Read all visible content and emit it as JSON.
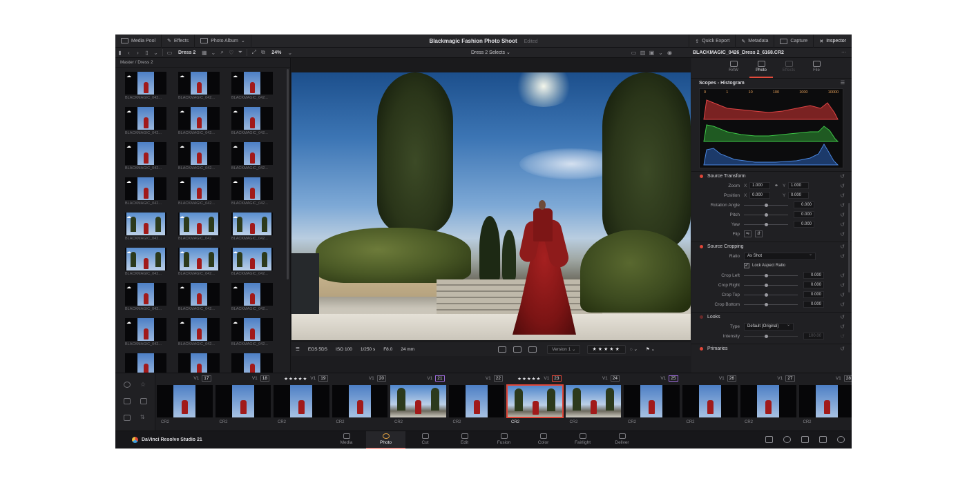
{
  "topbar": {
    "media_pool": "Media Pool",
    "effects": "Effects",
    "photo_album": "Photo Album",
    "project_title": "Blackmagic Fashion Photo Shoot",
    "edited": "Edited",
    "quick_export": "Quick Export",
    "metadata": "Metadata",
    "capture": "Capture",
    "inspector": "Inspector"
  },
  "toolbar": {
    "bin_name": "Dress 2",
    "zoom": "24%",
    "album": "Dress 2 Selects",
    "file_name": "BLACKMAGIC_0426_Dress 2_6168.CR2"
  },
  "pool": {
    "breadcrumb": "Master / Dress 2",
    "thumbnails": [
      {
        "name": "BLACKMAGIC_042..."
      },
      {
        "name": "BLACKMAGIC_042..."
      },
      {
        "name": "BLACKMAGIC_042..."
      },
      {
        "name": "BLACKMAGIC_042..."
      },
      {
        "name": "BLACKMAGIC_042..."
      },
      {
        "name": "BLACKMAGIC_042..."
      },
      {
        "name": "BLACKMAGIC_042..."
      },
      {
        "name": "BLACKMAGIC_042..."
      },
      {
        "name": "BLACKMAGIC_042..."
      },
      {
        "name": "BLACKMAGIC_042..."
      },
      {
        "name": "BLACKMAGIC_042..."
      },
      {
        "name": "BLACKMAGIC_042..."
      },
      {
        "name": "BLACKMAGIC_042..."
      },
      {
        "name": "BLACKMAGIC_042..."
      },
      {
        "name": "BLACKMAGIC_042..."
      },
      {
        "name": "BLACKMAGIC_042..."
      },
      {
        "name": "BLACKMAGIC_042..."
      },
      {
        "name": "BLACKMAGIC_042..."
      },
      {
        "name": "BLACKMAGIC_042..."
      },
      {
        "name": "BLACKMAGIC_042..."
      },
      {
        "name": "BLACKMAGIC_042..."
      },
      {
        "name": "BLACKMAGIC_042..."
      },
      {
        "name": "BLACKMAGIC_042..."
      },
      {
        "name": "BLACKMAGIC_042..."
      },
      {
        "name": ""
      },
      {
        "name": ""
      },
      {
        "name": ""
      }
    ]
  },
  "viewer": {
    "camera": "EOS 5DS",
    "iso": "ISO 100",
    "shutter": "1/250 s",
    "aperture": "F8.0",
    "focal": "24 mm",
    "version": "Version 1",
    "stars": "★★★★★"
  },
  "inspector": {
    "tabs": [
      "RAW",
      "Photo",
      "Effects",
      "File"
    ],
    "scopes_title": "Scopes - Histogram",
    "histogram_ticks": [
      "0",
      "1",
      "10",
      "100",
      "1000",
      "10000"
    ],
    "source_transform": {
      "title": "Source Transform",
      "zoom_label": "Zoom",
      "zoom_x": "1.000",
      "zoom_y": "1.000",
      "position_label": "Position",
      "position_x": "0.000",
      "position_y": "0.000",
      "rotation_label": "Rotation Angle",
      "rotation": "0.000",
      "pitch_label": "Pitch",
      "pitch": "0.000",
      "yaw_label": "Yaw",
      "yaw": "0.000",
      "flip_label": "Flip"
    },
    "source_cropping": {
      "title": "Source Cropping",
      "ratio_label": "Ratio",
      "ratio": "As Shot",
      "lock_label": "Lock Aspect Ratio",
      "crop_left_label": "Crop Left",
      "crop_left": "0.000",
      "crop_right_label": "Crop Right",
      "crop_right": "0.000",
      "crop_top_label": "Crop Top",
      "crop_top": "0.000",
      "crop_bottom_label": "Crop Bottom",
      "crop_bottom": "0.000"
    },
    "looks": {
      "title": "Looks",
      "type_label": "Type",
      "type": "Default (Original)",
      "intensity_label": "Intensity",
      "intensity": "100.00"
    },
    "primaries": {
      "title": "Primaries"
    }
  },
  "filmstrip": {
    "clips": [
      {
        "v": "V1",
        "num": "17",
        "stars": "",
        "ext": "CR2"
      },
      {
        "v": "V1",
        "num": "18",
        "stars": "",
        "ext": "CR2"
      },
      {
        "v": "V1",
        "num": "19",
        "stars": "★★★★★",
        "ext": "CR2"
      },
      {
        "v": "V1",
        "num": "20",
        "stars": "",
        "ext": "CR2"
      },
      {
        "v": "V1",
        "num": "21",
        "stars": "",
        "ext": "CR2"
      },
      {
        "v": "V1",
        "num": "22",
        "stars": "",
        "ext": "CR2"
      },
      {
        "v": "V1",
        "num": "23",
        "stars": "★★★★★",
        "ext": "CR2"
      },
      {
        "v": "V1",
        "num": "24",
        "stars": "",
        "ext": "CR2"
      },
      {
        "v": "V1",
        "num": "25",
        "stars": "",
        "ext": "CR2"
      },
      {
        "v": "V1",
        "num": "26",
        "stars": "",
        "ext": "CR2"
      },
      {
        "v": "V1",
        "num": "27",
        "stars": "",
        "ext": "CR2"
      },
      {
        "v": "V1",
        "num": "28",
        "stars": "",
        "ext": "CR2"
      }
    ]
  },
  "pagebar": {
    "brand": "DaVinci Resolve Studio 21",
    "pages": [
      "Media",
      "Photo",
      "Cut",
      "Edit",
      "Fusion",
      "Color",
      "Fairlight",
      "Deliver"
    ],
    "active_page": "Photo"
  },
  "colors": {
    "accent": "#e04638",
    "panel": "#1f1f22",
    "background": "#ffffff"
  }
}
